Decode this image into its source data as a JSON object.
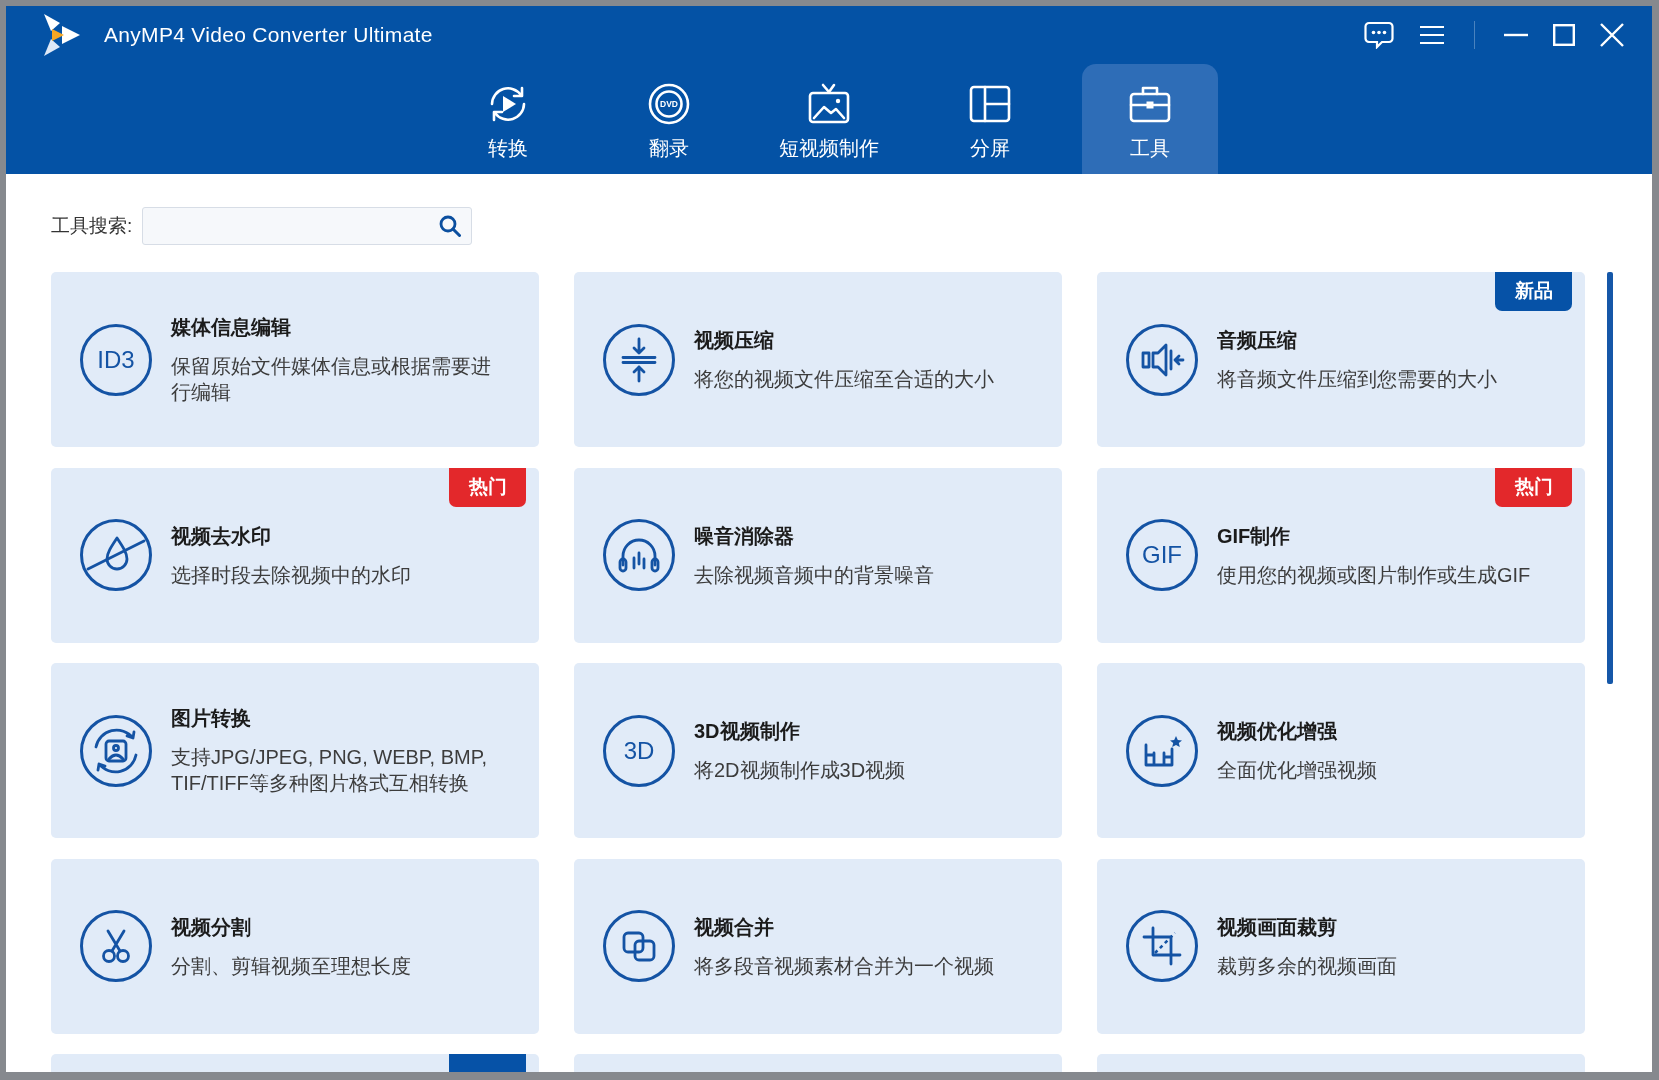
{
  "window": {
    "title": "AnyMP4 Video Converter Ultimate"
  },
  "tabs": [
    {
      "label": "转换",
      "selected": false
    },
    {
      "label": "翻录",
      "selected": false,
      "icon_label": "DVD"
    },
    {
      "label": "短视频制作",
      "selected": false
    },
    {
      "label": "分屏",
      "selected": false
    },
    {
      "label": "工具",
      "selected": true
    }
  ],
  "search": {
    "label": "工具搜索:"
  },
  "tools": [
    {
      "title": "媒体信息编辑",
      "description": "保留原始文件媒体信息或根据需要进行编辑",
      "icon_label": "ID3"
    },
    {
      "title": "视频压缩",
      "description": "将您的视频文件压缩至合适的大小"
    },
    {
      "title": "音频压缩",
      "description": "将音频文件压缩到您需要的大小",
      "badge": {
        "kind": "new",
        "text": "新品"
      }
    },
    {
      "title": "视频去水印",
      "description": "选择时段去除视频中的水印",
      "badge": {
        "kind": "hot",
        "text": "热门"
      }
    },
    {
      "title": "噪音消除器",
      "description": "去除视频音频中的背景噪音"
    },
    {
      "title": "GIF制作",
      "description": "使用您的视频或图片制作或生成GIF",
      "icon_label": "GIF",
      "badge": {
        "kind": "hot",
        "text": "热门"
      }
    },
    {
      "title": "图片转换",
      "description": "支持JPG/JPEG, PNG, WEBP, BMP, TIF/TIFF等多种图片格式互相转换"
    },
    {
      "title": "3D视频制作",
      "description": "将2D视频制作成3D视频",
      "icon_label": "3D"
    },
    {
      "title": "视频优化增强",
      "description": "全面优化增强视频"
    },
    {
      "title": "视频分割",
      "description": "分割、剪辑视频至理想长度"
    },
    {
      "title": "视频合并",
      "description": "将多段音视频素材合并为一个视频"
    },
    {
      "title": "视频画面裁剪",
      "description": "裁剪多余的视频画面"
    }
  ],
  "cut_off_tools": [
    {
      "tagged": true
    },
    {
      "tagged": false
    },
    {
      "tagged": false
    }
  ]
}
